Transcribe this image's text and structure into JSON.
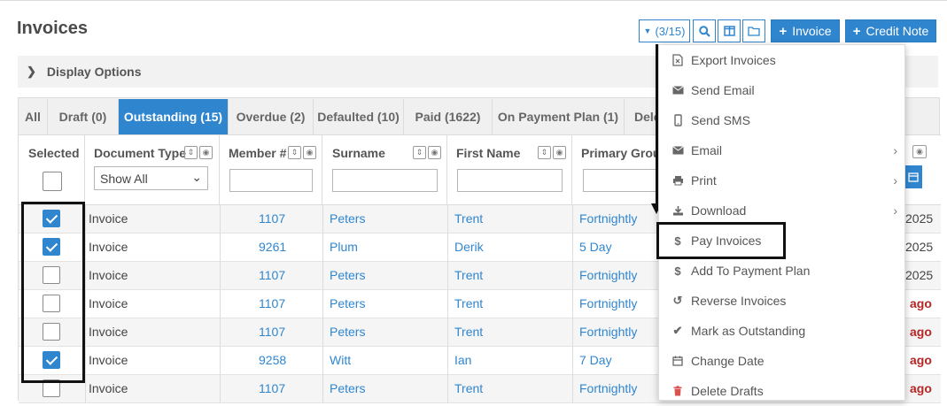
{
  "page": {
    "title": "Invoices"
  },
  "toolbar": {
    "filter_count": "(3/15)",
    "invoice_button": "Invoice",
    "credit_note_button": "Credit Note"
  },
  "display_options": {
    "label": "Display Options"
  },
  "tabs": [
    {
      "label": "All"
    },
    {
      "label": "Draft (0)"
    },
    {
      "label": "Outstanding (15)",
      "active": true
    },
    {
      "label": "Overdue (2)"
    },
    {
      "label": "Defaulted (10)"
    },
    {
      "label": "Paid (1622)"
    },
    {
      "label": "On Payment Plan (1)"
    },
    {
      "label": "Dele"
    }
  ],
  "columns": {
    "selected": "Selected",
    "document_type": "Document Type",
    "document_type_filter": "Show All",
    "member": "Member #",
    "surname": "Surname",
    "first_name": "First Name",
    "primary_group": "Primary Grou"
  },
  "rows": [
    {
      "checked": true,
      "doc_type": "Invoice",
      "member": "1107",
      "surname": "Peters",
      "first_name": "Trent",
      "group": "Fortnightly",
      "edge": "2025"
    },
    {
      "checked": true,
      "doc_type": "Invoice",
      "member": "9261",
      "surname": "Plum",
      "first_name": "Derik",
      "group": "5 Day",
      "edge": "2025"
    },
    {
      "checked": false,
      "doc_type": "Invoice",
      "member": "1107",
      "surname": "Peters",
      "first_name": "Trent",
      "group": "Fortnightly",
      "edge": "2025"
    },
    {
      "checked": false,
      "doc_type": "Invoice",
      "member": "1107",
      "surname": "Peters",
      "first_name": "Trent",
      "group": "Fortnightly",
      "edge": "ago"
    },
    {
      "checked": false,
      "doc_type": "Invoice",
      "member": "1107",
      "surname": "Peters",
      "first_name": "Trent",
      "group": "Fortnightly",
      "edge": "ago"
    },
    {
      "checked": true,
      "doc_type": "Invoice",
      "member": "9258",
      "surname": "Witt",
      "first_name": "Ian",
      "group": "7 Day",
      "edge": "ago"
    },
    {
      "checked": false,
      "doc_type": "Invoice",
      "member": "1107",
      "surname": "Peters",
      "first_name": "Trent",
      "group": "Fortnightly",
      "edge": "ago"
    }
  ],
  "menu": {
    "items": [
      {
        "label": "Export Invoices",
        "icon": "file-excel-icon"
      },
      {
        "label": "Send Email",
        "icon": "envelope-icon"
      },
      {
        "label": "Send SMS",
        "icon": "mobile-icon"
      },
      {
        "label": "Email",
        "icon": "envelope-icon",
        "submenu": true
      },
      {
        "label": "Print",
        "icon": "printer-icon",
        "submenu": true
      },
      {
        "label": "Download",
        "icon": "download-icon",
        "submenu": true
      },
      {
        "label": "Pay Invoices",
        "icon": "dollar-icon"
      },
      {
        "label": "Add To Payment Plan",
        "icon": "dollar-icon"
      },
      {
        "label": "Reverse Invoices",
        "icon": "undo-icon"
      },
      {
        "label": "Mark as Outstanding",
        "icon": "check-icon"
      },
      {
        "label": "Change Date",
        "icon": "calendar-icon"
      },
      {
        "label": "Delete Drafts",
        "icon": "trash-icon"
      }
    ]
  },
  "colors": {
    "primary": "#2f86cf",
    "ago": "#b72626",
    "trash": "#d9534f"
  }
}
